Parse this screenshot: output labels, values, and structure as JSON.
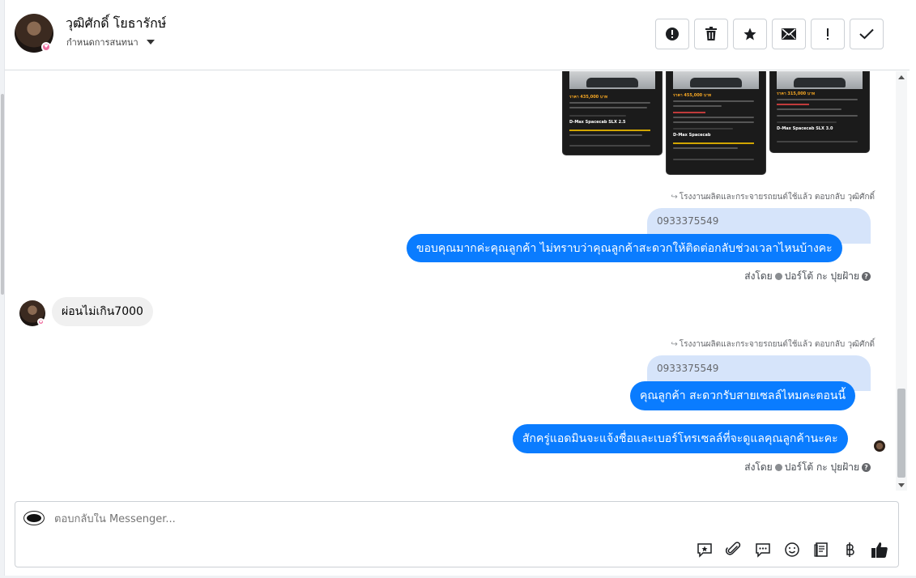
{
  "header": {
    "contact_name": "วุฒิศักดิ์ โยธารักษ์",
    "assign_label": "กำหนดการสนทนา",
    "toolbar": [
      {
        "name": "spam-icon",
        "glyph": "!"
      },
      {
        "name": "trash-icon",
        "glyph": "trash"
      },
      {
        "name": "star-icon",
        "glyph": "★"
      },
      {
        "name": "mail-icon",
        "glyph": "mail"
      },
      {
        "name": "exclamation-icon",
        "glyph": "!"
      },
      {
        "name": "check-icon",
        "glyph": "✓"
      }
    ]
  },
  "cards": [
    {
      "price": "ราคา 435,000 บาท",
      "model": "D-Max Spacecab SLX 2.5"
    },
    {
      "price": "ราคา 455,000 บาท",
      "model": "D-Max Spacecab"
    },
    {
      "price": "ราคา 315,000 บาท",
      "model": "D-Max Spacecab SLX 3.0"
    }
  ],
  "messages": {
    "reply_meta_1": "โรงงานผลิตและกระจายรถยนต์ใช้แล้ว ตอบกลับ วุฒิศักดิ์",
    "quote_1": "0933375549",
    "out_1": "ขอบคุณมากค่ะคุณลูกค้า ไม่ทราบว่าคุณลูกค้าสะดวกให้ติดต่อกลับช่วงเวลาไหนบ้างคะ",
    "sent_by_1": "ส่งโดย",
    "sender_1": "ปอร์โต้ กะ ปุยฝ้าย",
    "in_1": "ผ่อนไม่เกิน7000",
    "reply_meta_2": "โรงงานผลิตและกระจายรถยนต์ใช้แล้ว ตอบกลับ วุฒิศักดิ์",
    "quote_2": "0933375549",
    "out_2": "คุณลูกค้า สะดวกรับสายเซลล์ไหมคะตอนนี้",
    "out_3": "สักครู่แอดมินจะแจ้งชื่อและเบอร์โทรเซลล์ที่จะดูแลคุณลูกค้านะคะ",
    "sent_by_2": "ส่งโดย",
    "sender_2": "ปอร์โต้ กะ ปุยฝ้าย"
  },
  "composer": {
    "placeholder": "ตอบกลับใน Messenger..."
  },
  "colors": {
    "outgoing_bubble": "#0a7cff",
    "quote_bubble": "#d6e4fa",
    "incoming_bubble": "#f0f0f0"
  }
}
